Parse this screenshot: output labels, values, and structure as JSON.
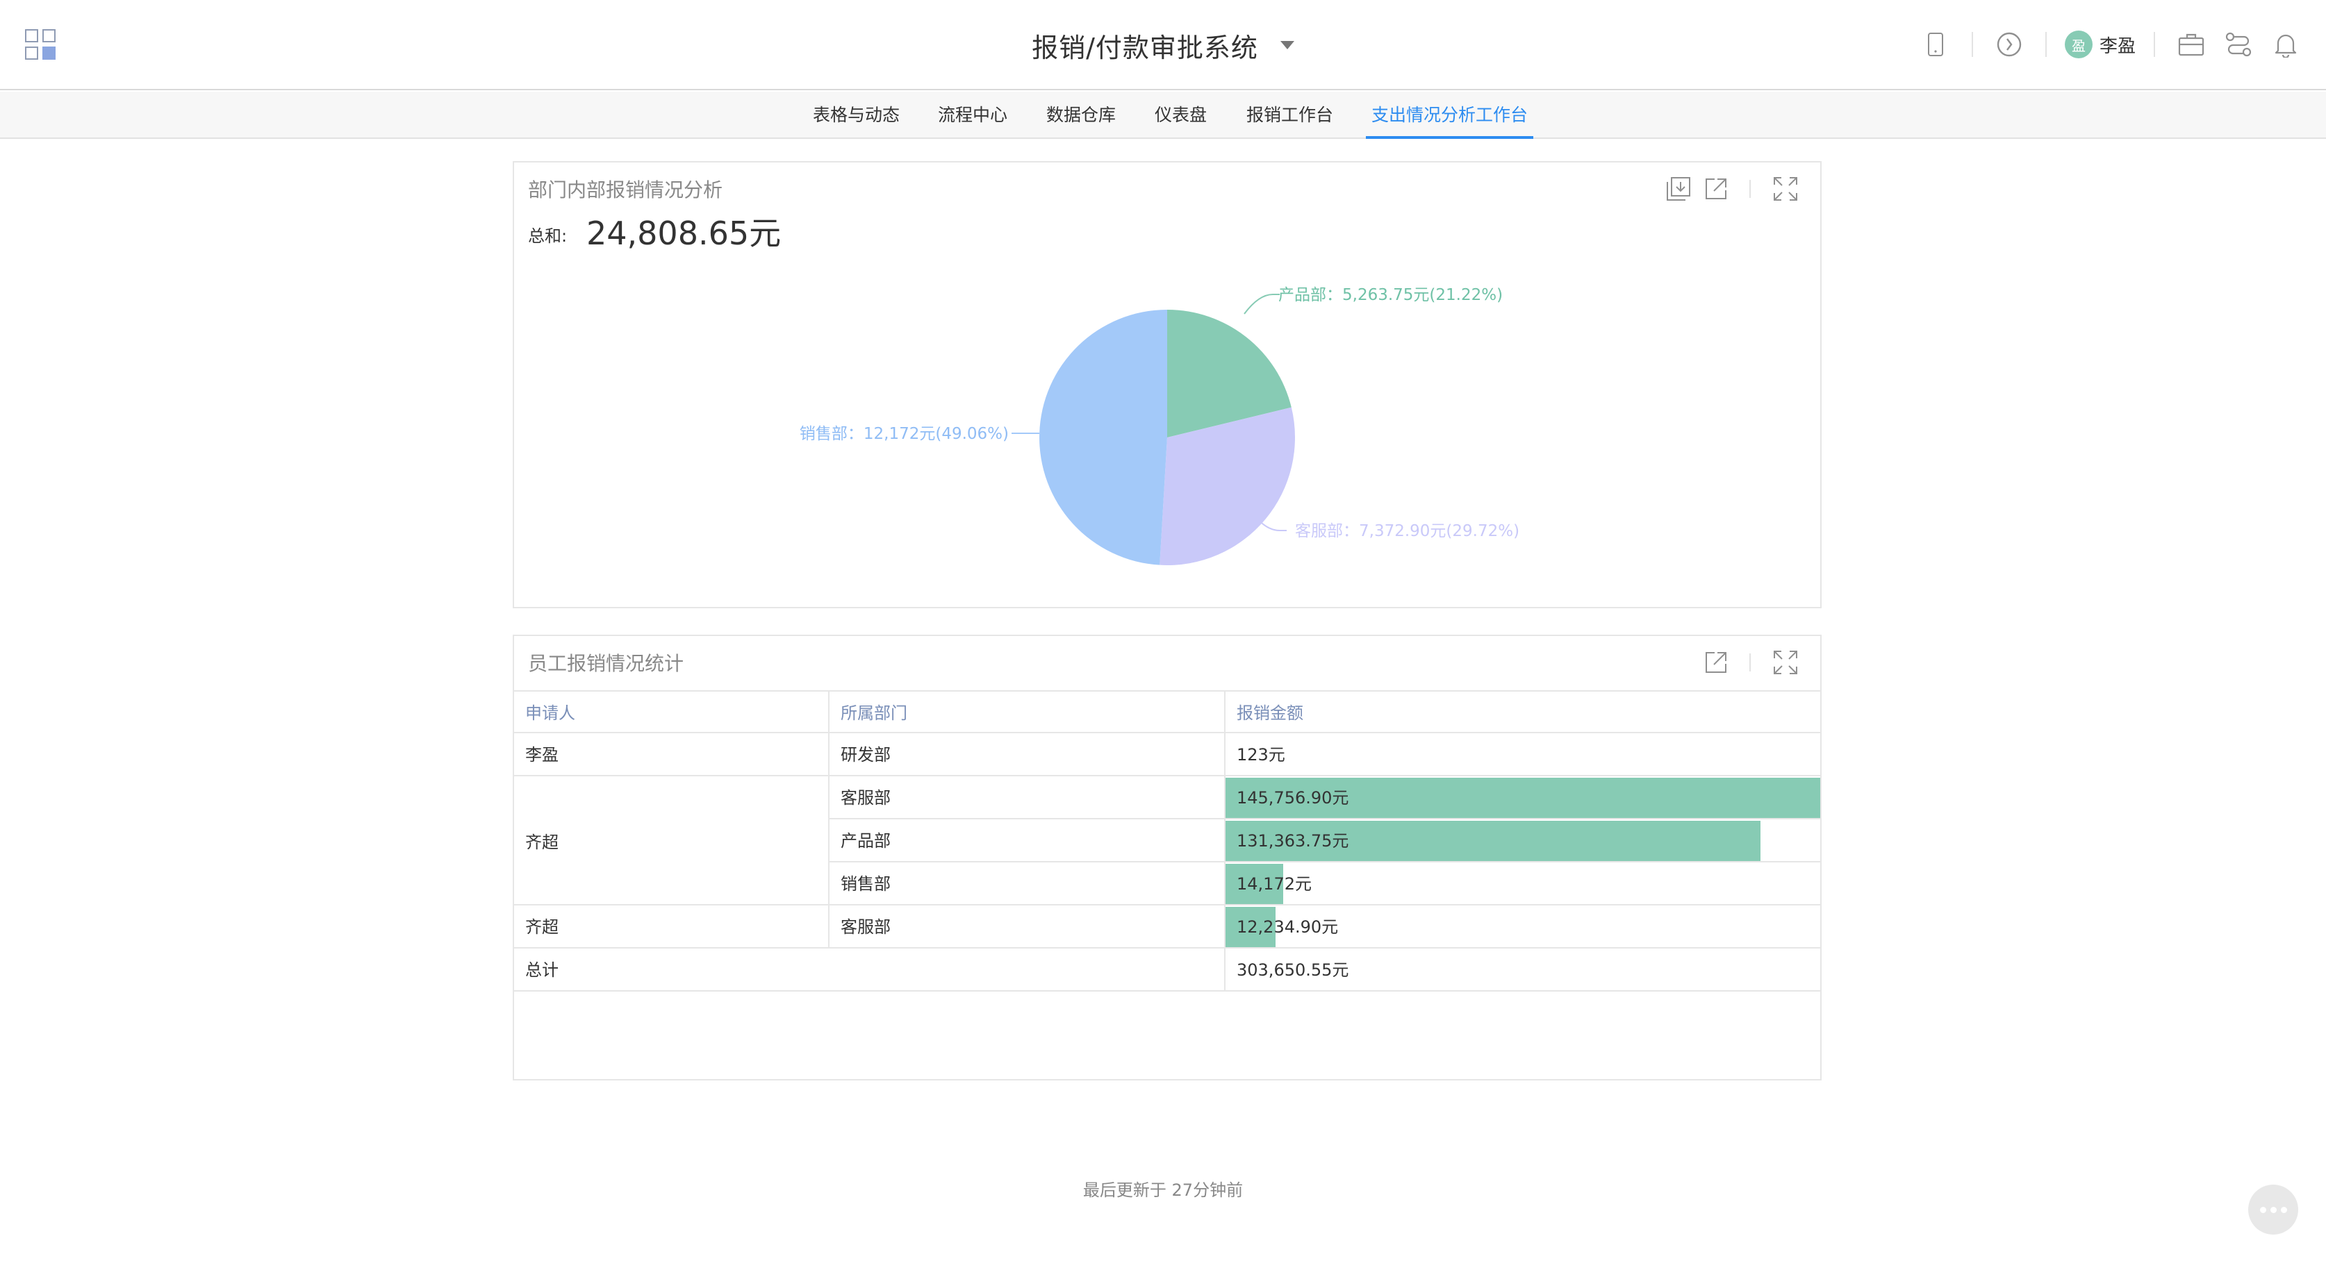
{
  "header": {
    "app_title": "报销/付款审批系统",
    "user": {
      "avatar_text": "盈",
      "name": "李盈"
    },
    "icons": [
      "apps-grid-icon",
      "mobile-icon",
      "clock-icon",
      "briefcase-icon",
      "workflow-icon",
      "bell-icon"
    ]
  },
  "tabs": [
    {
      "label": "表格与动态",
      "active": false
    },
    {
      "label": "流程中心",
      "active": false
    },
    {
      "label": "数据仓库",
      "active": false
    },
    {
      "label": "仪表盘",
      "active": false
    },
    {
      "label": "报销工作台",
      "active": false
    },
    {
      "label": "支出情况分析工作台",
      "active": true
    }
  ],
  "pie_card": {
    "title": "部门内部报销情况分析",
    "sum_label": "总和:",
    "sum_value": "24,808.65元",
    "slice_labels": {
      "product": "产品部：5,263.75元(21.22%)",
      "service": "客服部：7,372.90元(29.72%)",
      "sales": "销售部：12,172元(49.06%)"
    }
  },
  "chart_data": {
    "type": "pie",
    "categories": [
      "产品部",
      "客服部",
      "销售部"
    ],
    "values": [
      5263.75,
      7372.9,
      12172
    ],
    "percentages": [
      21.22,
      29.72,
      49.06
    ],
    "colors": [
      "#87cbb4",
      "#c9c9f9",
      "#a3c9f9"
    ],
    "start_angle_deg": -90,
    "direction": "clockwise"
  },
  "table_card": {
    "title": "员工报销情况统计",
    "columns": [
      "申请人",
      "所属部门",
      "报销金额"
    ],
    "rows": [
      {
        "applicant": "李盈",
        "department": "研发部",
        "amount": "123元",
        "bar_fraction": 0
      },
      {
        "applicant": "齐超",
        "department": "客服部",
        "amount": "145,756.90元",
        "bar_fraction": 1.0
      },
      {
        "applicant": "齐超",
        "department": "产品部",
        "amount": "131,363.75元",
        "bar_fraction": 0.9
      },
      {
        "applicant": "齐超",
        "department": "销售部",
        "amount": "14,172元",
        "bar_fraction": 0.097
      },
      {
        "applicant": "齐超",
        "department": "客服部",
        "amount": "12,234.90元",
        "bar_fraction": 0.084
      }
    ],
    "merged_applicant": "齐超",
    "total_label": "总计",
    "total_amount": "303,650.55元",
    "bar_color": "#87cbb4"
  },
  "footer": {
    "updated_text": "最后更新于 27分钟前"
  }
}
